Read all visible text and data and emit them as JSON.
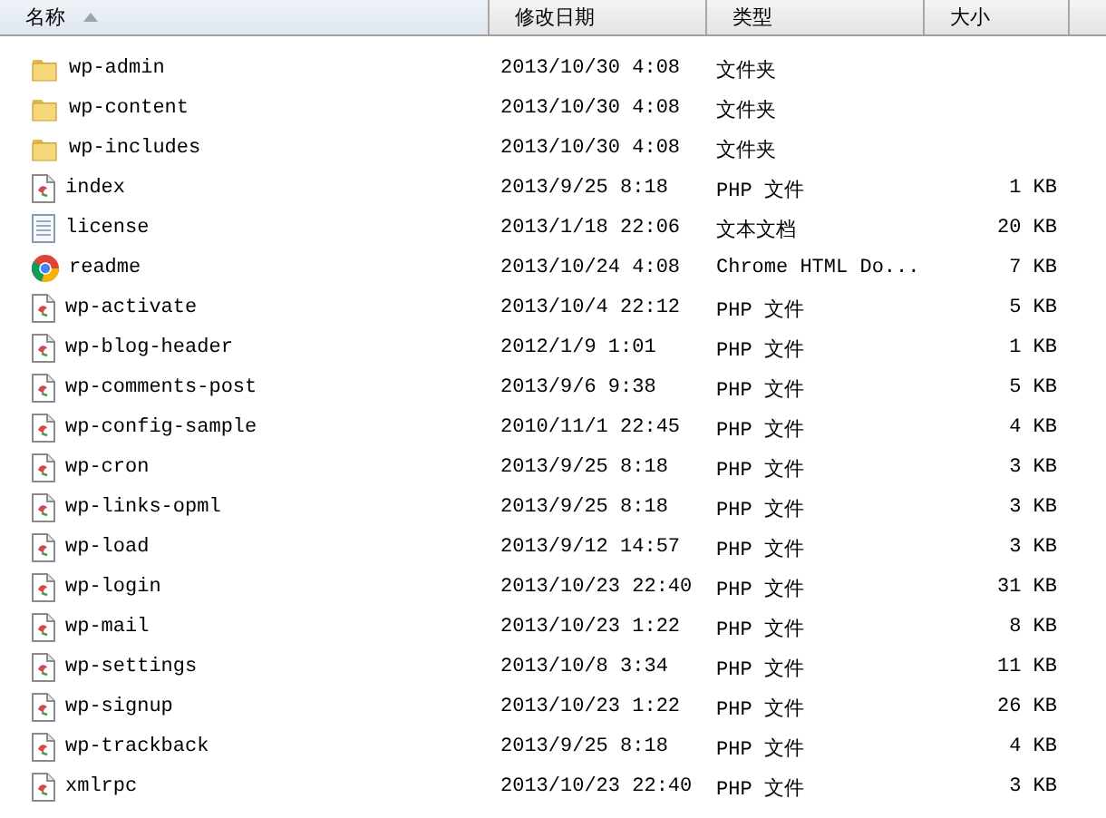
{
  "columns": [
    {
      "label": "名称",
      "sorted": true
    },
    {
      "label": "修改日期",
      "sorted": false
    },
    {
      "label": "类型",
      "sorted": false
    },
    {
      "label": "大小",
      "sorted": false
    }
  ],
  "rows": [
    {
      "kind": "folder",
      "name": "wp-admin",
      "date": "2013/10/30 4:08",
      "type": "文件夹"
    },
    {
      "kind": "folder",
      "name": "wp-content",
      "date": "2013/10/30 4:08",
      "type": "文件夹"
    },
    {
      "kind": "folder",
      "name": "wp-includes",
      "date": "2013/10/30 4:08",
      "type": "文件夹"
    },
    {
      "kind": "php",
      "name": "index",
      "date": "2013/9/25 8:18",
      "type": "PHP 文件",
      "size": "1 KB"
    },
    {
      "kind": "text",
      "name": "license",
      "date": "2013/1/18 22:06",
      "type": "文本文档",
      "size": "20 KB"
    },
    {
      "kind": "chrome",
      "name": "readme",
      "date": "2013/10/24 4:08",
      "type": "Chrome HTML Do...",
      "size": "7 KB"
    },
    {
      "kind": "php",
      "name": "wp-activate",
      "date": "2013/10/4 22:12",
      "type": "PHP 文件",
      "size": "5 KB"
    },
    {
      "kind": "php",
      "name": "wp-blog-header",
      "date": "2012/1/9 1:01",
      "type": "PHP 文件",
      "size": "1 KB"
    },
    {
      "kind": "php",
      "name": "wp-comments-post",
      "date": "2013/9/6 9:38",
      "type": "PHP 文件",
      "size": "5 KB"
    },
    {
      "kind": "php",
      "name": "wp-config-sample",
      "date": "2010/11/1 22:45",
      "type": "PHP 文件",
      "size": "4 KB"
    },
    {
      "kind": "php",
      "name": "wp-cron",
      "date": "2013/9/25 8:18",
      "type": "PHP 文件",
      "size": "3 KB"
    },
    {
      "kind": "php",
      "name": "wp-links-opml",
      "date": "2013/9/25 8:18",
      "type": "PHP 文件",
      "size": "3 KB"
    },
    {
      "kind": "php",
      "name": "wp-load",
      "date": "2013/9/12 14:57",
      "type": "PHP 文件",
      "size": "3 KB"
    },
    {
      "kind": "php",
      "name": "wp-login",
      "date": "2013/10/23 22:40",
      "type": "PHP 文件",
      "size": "31 KB"
    },
    {
      "kind": "php",
      "name": "wp-mail",
      "date": "2013/10/23 1:22",
      "type": "PHP 文件",
      "size": "8 KB"
    },
    {
      "kind": "php",
      "name": "wp-settings",
      "date": "2013/10/8 3:34",
      "type": "PHP 文件",
      "size": "11 KB"
    },
    {
      "kind": "php",
      "name": "wp-signup",
      "date": "2013/10/23 1:22",
      "type": "PHP 文件",
      "size": "26 KB"
    },
    {
      "kind": "php",
      "name": "wp-trackback",
      "date": "2013/9/25 8:18",
      "type": "PHP 文件",
      "size": "4 KB"
    },
    {
      "kind": "php",
      "name": "xmlrpc",
      "date": "2013/10/23 22:40",
      "type": "PHP 文件",
      "size": "3 KB"
    }
  ]
}
